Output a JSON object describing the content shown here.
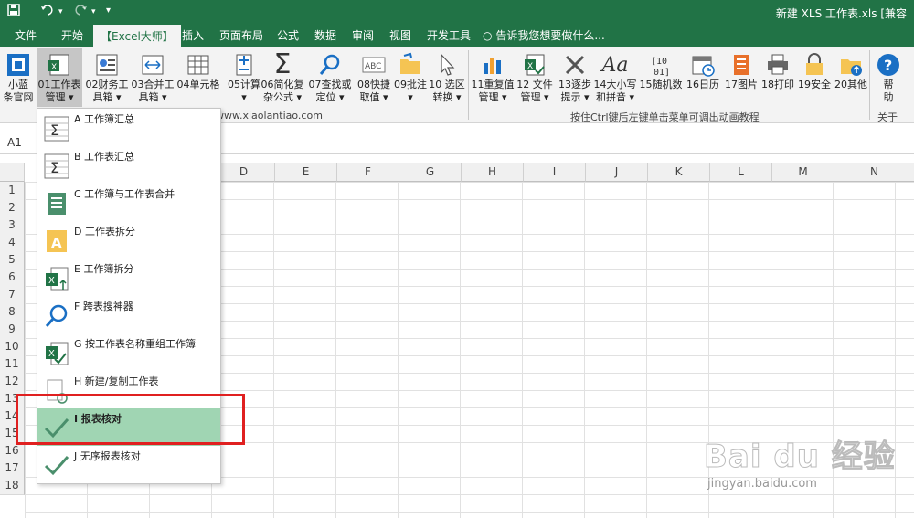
{
  "titlebar": {
    "save_icon": "save-icon",
    "undo_icon": "undo-icon",
    "redo_icon": "redo-icon",
    "customize_icon": "customize-quick-access-icon",
    "title": "新建 XLS 工作表.xls  [兼容"
  },
  "tabs": [
    {
      "label": "文件"
    },
    {
      "label": "开始"
    },
    {
      "label": "【Excel大师】"
    },
    {
      "label": "插入"
    },
    {
      "label": "页面布局"
    },
    {
      "label": "公式"
    },
    {
      "label": "数据"
    },
    {
      "label": "审阅"
    },
    {
      "label": "视图"
    },
    {
      "label": "开发工具"
    }
  ],
  "tell_me": "告诉我您想要做什么...",
  "ribbon": {
    "buttons": [
      {
        "line1": "小蓝",
        "line2": "条官网"
      },
      {
        "line1": "01工作表",
        "line2": "管理 ▾"
      },
      {
        "line1": "02财务工",
        "line2": "具箱 ▾"
      },
      {
        "line1": "03合并工",
        "line2": "具箱 ▾"
      },
      {
        "line1": "04单元格",
        "line2": ""
      },
      {
        "line1": "05计算",
        "line2": "▾"
      },
      {
        "line1": "06简化复",
        "line2": "杂公式 ▾"
      },
      {
        "line1": "07查找或",
        "line2": "定位 ▾"
      },
      {
        "line1": "08快捷",
        "line2": "取值 ▾"
      },
      {
        "line1": "09批注",
        "line2": "▾"
      },
      {
        "line1": "10 选区",
        "line2": "转换 ▾"
      },
      {
        "line1": "11重复值",
        "line2": "管理 ▾"
      },
      {
        "line1": "12 文件",
        "line2": "管理 ▾"
      },
      {
        "line1": "13逐步",
        "line2": "提示 ▾"
      },
      {
        "line1": "14大小写",
        "line2": "和拼音 ▾"
      },
      {
        "line1": "15随机数",
        "line2": ""
      },
      {
        "line1": "16日历",
        "line2": ""
      },
      {
        "line1": "17图片",
        "line2": ""
      },
      {
        "line1": "18打印",
        "line2": ""
      },
      {
        "line1": "19安全",
        "line2": ""
      },
      {
        "line1": "20其他",
        "line2": ""
      },
      {
        "line1": "帮",
        "line2": "助"
      }
    ],
    "group_label_site": "www.xiaolantiao.com",
    "group_label_hint": "按住Ctrl键后左键单击菜单可调出动画教程",
    "group_label_about": "关于"
  },
  "namebox": {
    "value": "A1"
  },
  "columns": [
    "D",
    "E",
    "F",
    "G",
    "H",
    "I",
    "J",
    "K",
    "L",
    "M",
    "N"
  ],
  "rows": [
    "1",
    "2",
    "3",
    "4",
    "5",
    "6",
    "7",
    "8",
    "9",
    "10",
    "11",
    "12",
    "13",
    "14",
    "15",
    "16",
    "17",
    "18"
  ],
  "menu": {
    "items": [
      {
        "label": "A 工作簿汇总",
        "icon": "sum-icon"
      },
      {
        "label": "B 工作表汇总",
        "icon": "sum-icon"
      },
      {
        "label": "C 工作簿与工作表合并",
        "icon": "merge-icon"
      },
      {
        "label": "D 工作表拆分",
        "icon": "split-icon"
      },
      {
        "label": "E 工作簿拆分",
        "icon": "excel-split-icon"
      },
      {
        "label": "F 跨表搜神器",
        "icon": "magnifier-icon"
      },
      {
        "label": "G 按工作表名称重组工作簿",
        "icon": "excel-check-icon"
      },
      {
        "label": "H 新建/复制工作表",
        "icon": "new-copy-icon"
      },
      {
        "label": "I 报表核对",
        "icon": "check-icon"
      },
      {
        "label": "J 无序报表核对",
        "icon": "check-icon"
      }
    ],
    "selected_index": 8
  },
  "watermark": {
    "line1": "Bai du 经验",
    "line2": "jingyan.baidu.com"
  },
  "colors": {
    "excel_green": "#217346",
    "selection_green": "#a0d5b3",
    "highlight_red": "#e02020"
  }
}
